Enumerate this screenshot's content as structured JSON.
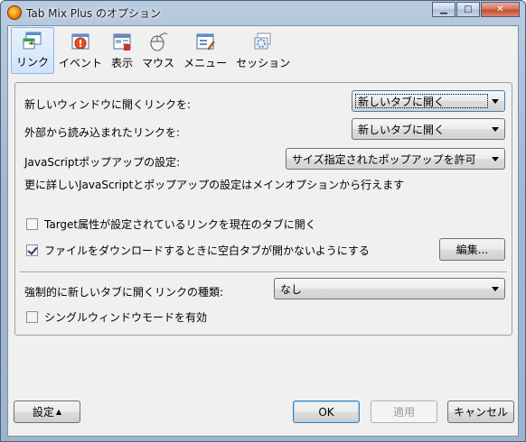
{
  "window": {
    "title": "Tab Mix Plus のオプション"
  },
  "caption": {
    "minimize": "▁",
    "maximize": "□",
    "close": "✕"
  },
  "toolbar": {
    "items": [
      {
        "label": "リンク",
        "icon": "link-icon"
      },
      {
        "label": "イベント",
        "icon": "event-icon"
      },
      {
        "label": "表示",
        "icon": "display-icon"
      },
      {
        "label": "マウス",
        "icon": "mouse-icon"
      },
      {
        "label": "メニュー",
        "icon": "menu-icon"
      },
      {
        "label": "セッション",
        "icon": "session-icon"
      }
    ],
    "selected": "リンク"
  },
  "links": {
    "new_window_label": "新しいウィンドウに開くリンクを:",
    "new_window_value": "新しいタブに開く",
    "external_label": "外部から読み込まれたリンクを:",
    "external_value": "新しいタブに開く",
    "js_popup_label": "JavaScriptポップアップの設定:",
    "js_popup_value": "サイズ指定されたポップアップを許可",
    "js_note": "更に詳しいJavaScriptとポップアップの設定はメインオプションから行えます",
    "target_attr_label": "Target属性が設定されているリンクを現在のタブに開く",
    "target_attr_checked": false,
    "download_label": "ファイルをダウンロードするときに空白タブが開かないようにする",
    "download_checked": true,
    "edit_button": "編集...",
    "force_new_tab_label": "強制的に新しいタブに開くリンクの種類:",
    "force_new_tab_value": "なし",
    "single_window_label": "シングルウィンドウモードを有効",
    "single_window_checked": false
  },
  "footer": {
    "settings_button": "設定",
    "settings_arrow": "▲",
    "ok_button": "OK",
    "apply_button": "適用",
    "cancel_button": "キャンセル"
  }
}
